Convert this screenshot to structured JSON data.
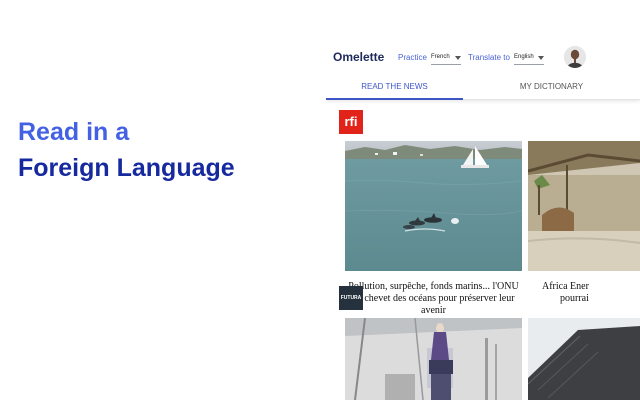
{
  "promo": {
    "line1": "Read in a",
    "line2": "Foreign Language"
  },
  "app": {
    "brand": "Omelette",
    "practice_label": "Practice",
    "practice_value": "French",
    "translate_label": "Translate to",
    "translate_value": "English",
    "tabs": [
      {
        "label": "READ THE NEWS",
        "active": true
      },
      {
        "label": "MY DICTIONARY",
        "active": false
      }
    ],
    "sources": [
      {
        "logo_text": "rfi",
        "articles": [
          {
            "headline_line1": "Pollution, surpêche, fonds marins... l'ONU",
            "headline_line2": "au chevet des océans pour préserver leur",
            "headline_line3": "avenir"
          },
          {
            "headline_line1": "Africa Ener",
            "headline_line2": "pourrai",
            "headline_line3": ""
          }
        ]
      },
      {
        "logo_text": "FUTURA"
      }
    ]
  },
  "colors": {
    "promo_light": "#4461e4",
    "promo_dark": "#16299e",
    "accent": "#3e55c8",
    "rfi_red": "#e2231a"
  }
}
